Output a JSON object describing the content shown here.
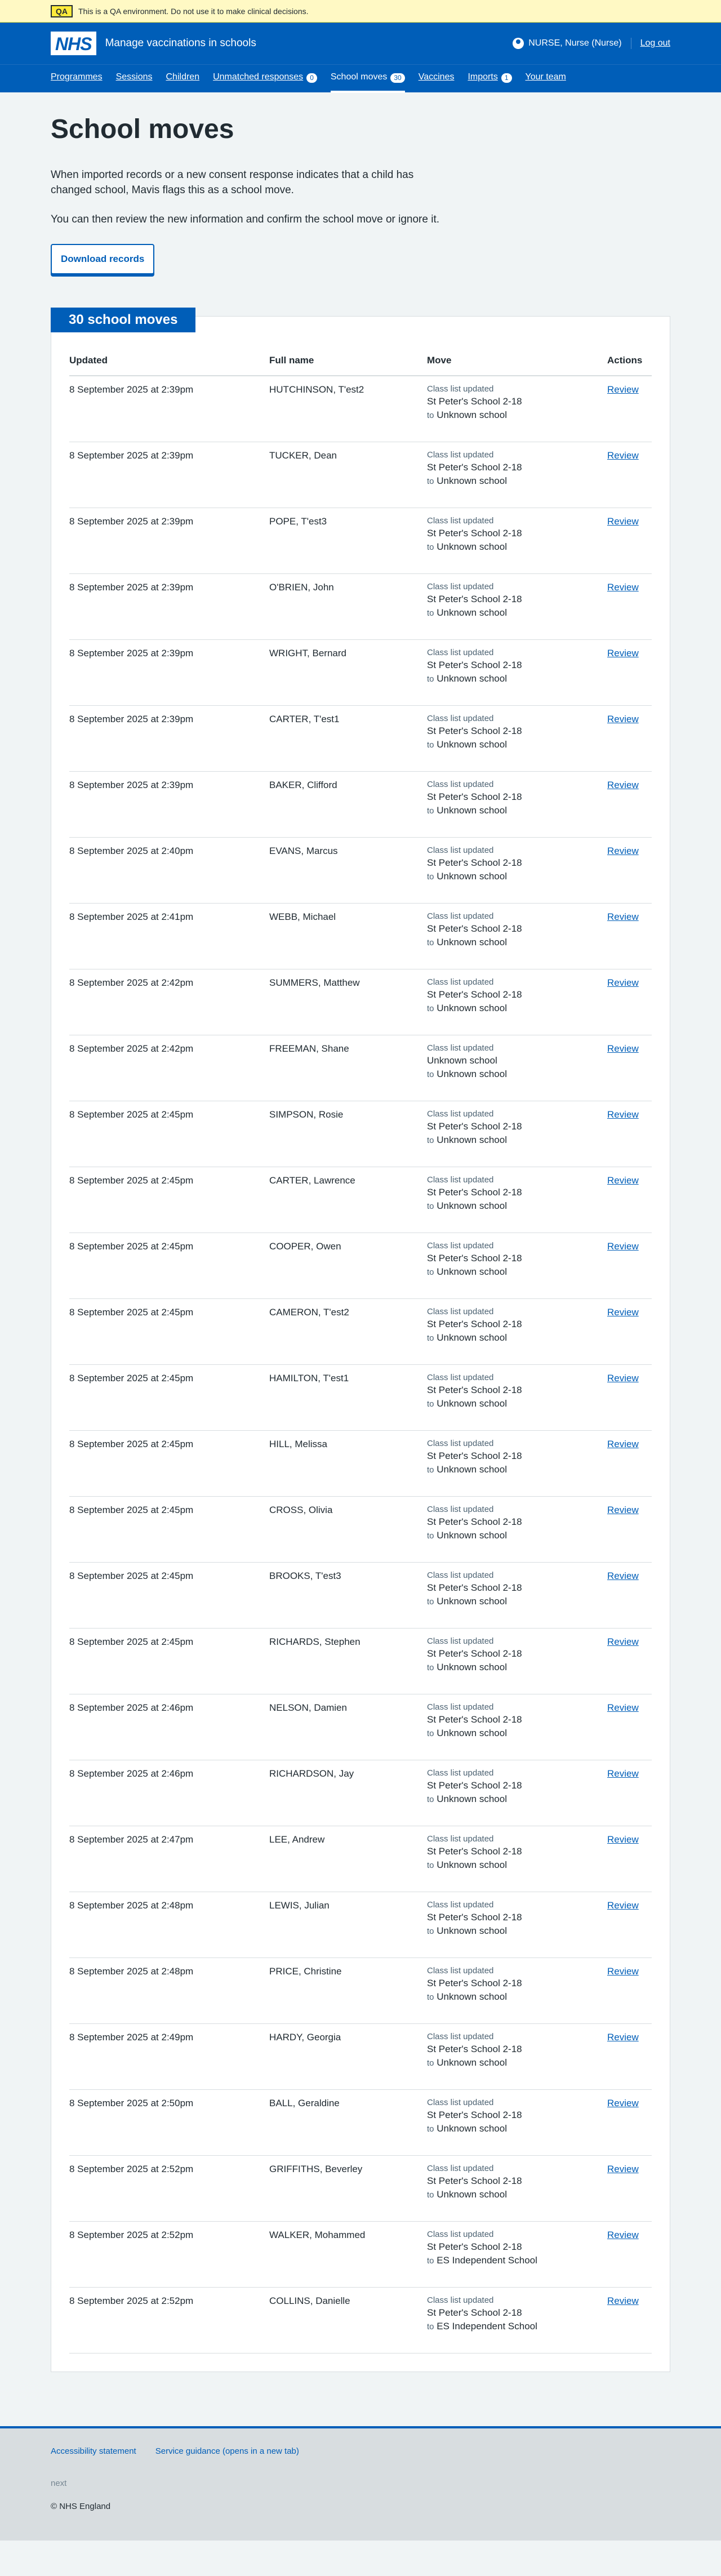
{
  "qa_banner": {
    "tag": "QA",
    "message": "This is a QA environment. Do not use it to make clinical decisions."
  },
  "header": {
    "logo": "NHS",
    "service_name": "Manage vaccinations in schools",
    "user_name": "NURSE, Nurse (Nurse)",
    "logout_label": "Log out"
  },
  "nav": {
    "items": [
      {
        "label": "Programmes"
      },
      {
        "label": "Sessions"
      },
      {
        "label": "Children"
      },
      {
        "label": "Unmatched responses",
        "count": "0"
      },
      {
        "label": "School moves",
        "count": "30"
      },
      {
        "label": "Vaccines"
      },
      {
        "label": "Imports",
        "count": "1"
      },
      {
        "label": "Your team"
      }
    ]
  },
  "main": {
    "title": "School moves",
    "intro_1": "When imported records or a new consent response indicates that a child has changed school, Mavis flags this as a school move.",
    "intro_2": "You can then review the new information and confirm the school move or ignore it.",
    "download_label": "Download records"
  },
  "table": {
    "heading": "30 school moves",
    "columns": [
      "Updated",
      "Full name",
      "Move",
      "Actions"
    ],
    "rows": [
      {
        "updated": "8 September 2025 at 2:39pm",
        "name": "HUTCHINSON, T'est2",
        "source": "Class list updated",
        "from": "St Peter's School 2-18",
        "to": "Unknown school",
        "action": "Review"
      },
      {
        "updated": "8 September 2025 at 2:39pm",
        "name": "TUCKER, Dean",
        "source": "Class list updated",
        "from": "St Peter's School 2-18",
        "to": "Unknown school",
        "action": "Review"
      },
      {
        "updated": "8 September 2025 at 2:39pm",
        "name": "POPE, T'est3",
        "source": "Class list updated",
        "from": "St Peter's School 2-18",
        "to": "Unknown school",
        "action": "Review"
      },
      {
        "updated": "8 September 2025 at 2:39pm",
        "name": "O'BRIEN, John",
        "source": "Class list updated",
        "from": "St Peter's School 2-18",
        "to": "Unknown school",
        "action": "Review"
      },
      {
        "updated": "8 September 2025 at 2:39pm",
        "name": "WRIGHT, Bernard",
        "source": "Class list updated",
        "from": "St Peter's School 2-18",
        "to": "Unknown school",
        "action": "Review"
      },
      {
        "updated": "8 September 2025 at 2:39pm",
        "name": "CARTER, T'est1",
        "source": "Class list updated",
        "from": "St Peter's School 2-18",
        "to": "Unknown school",
        "action": "Review"
      },
      {
        "updated": "8 September 2025 at 2:39pm",
        "name": "BAKER, Clifford",
        "source": "Class list updated",
        "from": "St Peter's School 2-18",
        "to": "Unknown school",
        "action": "Review"
      },
      {
        "updated": "8 September 2025 at 2:40pm",
        "name": "EVANS, Marcus",
        "source": "Class list updated",
        "from": "St Peter's School 2-18",
        "to": "Unknown school",
        "action": "Review"
      },
      {
        "updated": "8 September 2025 at 2:41pm",
        "name": "WEBB, Michael",
        "source": "Class list updated",
        "from": "St Peter's School 2-18",
        "to": "Unknown school",
        "action": "Review"
      },
      {
        "updated": "8 September 2025 at 2:42pm",
        "name": "SUMMERS, Matthew",
        "source": "Class list updated",
        "from": "St Peter's School 2-18",
        "to": "Unknown school",
        "action": "Review"
      },
      {
        "updated": "8 September 2025 at 2:42pm",
        "name": "FREEMAN, Shane",
        "source": "Class list updated",
        "from": "Unknown school",
        "to": "Unknown school",
        "action": "Review"
      },
      {
        "updated": "8 September 2025 at 2:45pm",
        "name": "SIMPSON, Rosie",
        "source": "Class list updated",
        "from": "St Peter's School 2-18",
        "to": "Unknown school",
        "action": "Review"
      },
      {
        "updated": "8 September 2025 at 2:45pm",
        "name": "CARTER, Lawrence",
        "source": "Class list updated",
        "from": "St Peter's School 2-18",
        "to": "Unknown school",
        "action": "Review"
      },
      {
        "updated": "8 September 2025 at 2:45pm",
        "name": "COOPER, Owen",
        "source": "Class list updated",
        "from": "St Peter's School 2-18",
        "to": "Unknown school",
        "action": "Review"
      },
      {
        "updated": "8 September 2025 at 2:45pm",
        "name": "CAMERON, T'est2",
        "source": "Class list updated",
        "from": "St Peter's School 2-18",
        "to": "Unknown school",
        "action": "Review"
      },
      {
        "updated": "8 September 2025 at 2:45pm",
        "name": "HAMILTON, T'est1",
        "source": "Class list updated",
        "from": "St Peter's School 2-18",
        "to": "Unknown school",
        "action": "Review"
      },
      {
        "updated": "8 September 2025 at 2:45pm",
        "name": "HILL, Melissa",
        "source": "Class list updated",
        "from": "St Peter's School 2-18",
        "to": "Unknown school",
        "action": "Review"
      },
      {
        "updated": "8 September 2025 at 2:45pm",
        "name": "CROSS, Olivia",
        "source": "Class list updated",
        "from": "St Peter's School 2-18",
        "to": "Unknown school",
        "action": "Review"
      },
      {
        "updated": "8 September 2025 at 2:45pm",
        "name": "BROOKS, T'est3",
        "source": "Class list updated",
        "from": "St Peter's School 2-18",
        "to": "Unknown school",
        "action": "Review"
      },
      {
        "updated": "8 September 2025 at 2:45pm",
        "name": "RICHARDS, Stephen",
        "source": "Class list updated",
        "from": "St Peter's School 2-18",
        "to": "Unknown school",
        "action": "Review"
      },
      {
        "updated": "8 September 2025 at 2:46pm",
        "name": "NELSON, Damien",
        "source": "Class list updated",
        "from": "St Peter's School 2-18",
        "to": "Unknown school",
        "action": "Review"
      },
      {
        "updated": "8 September 2025 at 2:46pm",
        "name": "RICHARDSON, Jay",
        "source": "Class list updated",
        "from": "St Peter's School 2-18",
        "to": "Unknown school",
        "action": "Review"
      },
      {
        "updated": "8 September 2025 at 2:47pm",
        "name": "LEE, Andrew",
        "source": "Class list updated",
        "from": "St Peter's School 2-18",
        "to": "Unknown school",
        "action": "Review"
      },
      {
        "updated": "8 September 2025 at 2:48pm",
        "name": "LEWIS, Julian",
        "source": "Class list updated",
        "from": "St Peter's School 2-18",
        "to": "Unknown school",
        "action": "Review"
      },
      {
        "updated": "8 September 2025 at 2:48pm",
        "name": "PRICE, Christine",
        "source": "Class list updated",
        "from": "St Peter's School 2-18",
        "to": "Unknown school",
        "action": "Review"
      },
      {
        "updated": "8 September 2025 at 2:49pm",
        "name": "HARDY, Georgia",
        "source": "Class list updated",
        "from": "St Peter's School 2-18",
        "to": "Unknown school",
        "action": "Review"
      },
      {
        "updated": "8 September 2025 at 2:50pm",
        "name": "BALL, Geraldine",
        "source": "Class list updated",
        "from": "St Peter's School 2-18",
        "to": "Unknown school",
        "action": "Review"
      },
      {
        "updated": "8 September 2025 at 2:52pm",
        "name": "GRIFFITHS, Beverley",
        "source": "Class list updated",
        "from": "St Peter's School 2-18",
        "to": "Unknown school",
        "action": "Review"
      },
      {
        "updated": "8 September 2025 at 2:52pm",
        "name": "WALKER, Mohammed",
        "source": "Class list updated",
        "from": "St Peter's School 2-18",
        "to": "ES Independent School",
        "action": "Review"
      },
      {
        "updated": "8 September 2025 at 2:52pm",
        "name": "COLLINS, Danielle",
        "source": "Class list updated",
        "from": "St Peter's School 2-18",
        "to": "ES Independent School",
        "action": "Review"
      }
    ]
  },
  "to_word": "to",
  "footer": {
    "accessibility_label": "Accessibility statement",
    "guidance_label": "Service guidance (opens in a new tab)",
    "version": "next",
    "copyright": "© NHS England"
  },
  "colors": {
    "nhs_blue": "#005eb8",
    "background": "#f0f4f5",
    "qa_banner": "#fff9c4"
  }
}
